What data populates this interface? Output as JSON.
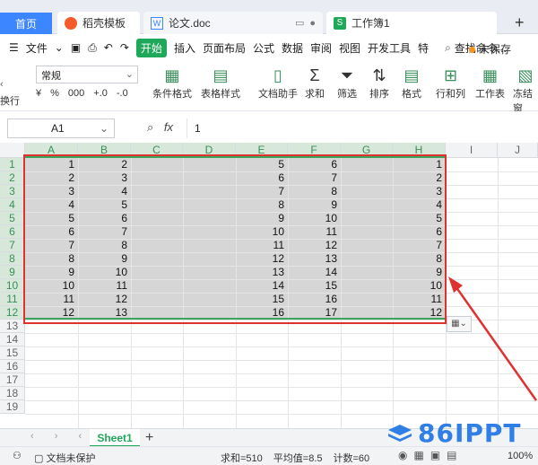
{
  "tabs": {
    "home": "首页",
    "template": "稻壳模板",
    "doc": "论文.doc",
    "workbook": "工作簿1"
  },
  "menu": {
    "file": "文件",
    "start": "开始",
    "items": [
      "插入",
      "页面布局",
      "公式",
      "数据",
      "审阅",
      "视图",
      "开发工具",
      "特"
    ],
    "search": "查找命令...",
    "unsaved": "未保存"
  },
  "ribbon": {
    "left_label": "换行",
    "number_format": "常规",
    "buttons": [
      "条件格式",
      "表格样式",
      "文档助手",
      "求和",
      "筛选",
      "排序",
      "格式",
      "行和列",
      "工作表",
      "冻结窗"
    ]
  },
  "formula_bar": {
    "name_box": "A1",
    "fx": "fx",
    "value": "1"
  },
  "columns": [
    "A",
    "B",
    "C",
    "D",
    "E",
    "F",
    "G",
    "H",
    "I",
    "J"
  ],
  "rows": [
    "1",
    "2",
    "3",
    "4",
    "5",
    "6",
    "7",
    "8",
    "9",
    "10",
    "11",
    "12",
    "13",
    "14",
    "15",
    "16",
    "17",
    "18",
    "19"
  ],
  "cell_data": {
    "A": [
      "1",
      "2",
      "3",
      "4",
      "5",
      "6",
      "7",
      "8",
      "9",
      "10",
      "11",
      "12"
    ],
    "B": [
      "2",
      "3",
      "4",
      "5",
      "6",
      "7",
      "8",
      "9",
      "10",
      "11",
      "12",
      "13"
    ],
    "E": [
      "5",
      "6",
      "7",
      "8",
      "9",
      "10",
      "11",
      "12",
      "13",
      "14",
      "15",
      "16"
    ],
    "F": [
      "6",
      "7",
      "8",
      "9",
      "10",
      "11",
      "12",
      "13",
      "14",
      "15",
      "16",
      "17"
    ],
    "H": [
      "1",
      "2",
      "3",
      "4",
      "5",
      "6",
      "7",
      "8",
      "9",
      "10",
      "11",
      "12"
    ]
  },
  "sheet": {
    "name": "Sheet1",
    "add": "+"
  },
  "status": {
    "protection": "文档未保护",
    "sum": "求和=510",
    "avg": "平均值=8.5",
    "count": "计数=60",
    "zoom": "100%"
  },
  "watermark": "86IPPT"
}
